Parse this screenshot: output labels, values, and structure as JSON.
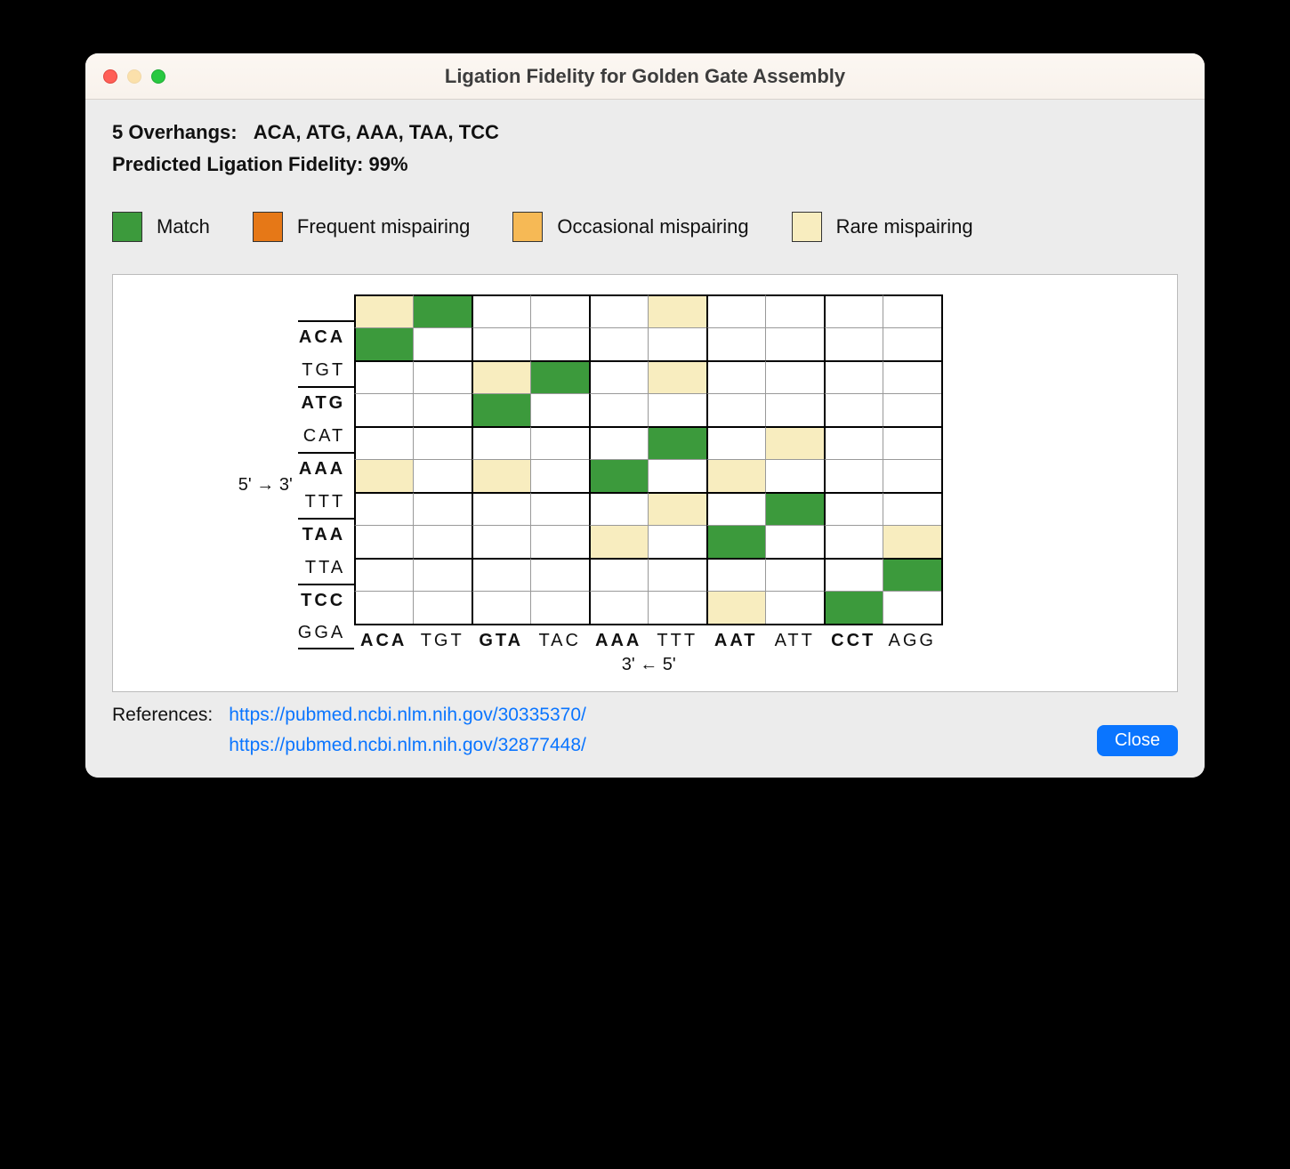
{
  "window": {
    "title": "Ligation Fidelity for Golden Gate Assembly"
  },
  "overhangs_label": "5 Overhangs:",
  "overhangs_list": "ACA, ATG, AAA, TAA, TCC",
  "fidelity_label": "Predicted Ligation Fidelity: 99%",
  "legend": {
    "match": "Match",
    "frequent": "Frequent mispairing",
    "occasional": "Occasional mispairing",
    "rare": "Rare mispairing"
  },
  "axes": {
    "y": "5' → 3'",
    "x": "3' ← 5'"
  },
  "row_headers": [
    {
      "label": "ACA",
      "bold": true
    },
    {
      "label": "TGT",
      "bold": false
    },
    {
      "label": "ATG",
      "bold": true
    },
    {
      "label": "CAT",
      "bold": false
    },
    {
      "label": "AAA",
      "bold": true
    },
    {
      "label": "TTT",
      "bold": false
    },
    {
      "label": "TAA",
      "bold": true
    },
    {
      "label": "TTA",
      "bold": false
    },
    {
      "label": "TCC",
      "bold": true
    },
    {
      "label": "GGA",
      "bold": false
    }
  ],
  "col_headers": [
    {
      "label": "ACA",
      "bold": true
    },
    {
      "label": "TGT",
      "bold": false
    },
    {
      "label": "GTA",
      "bold": true
    },
    {
      "label": "TAC",
      "bold": false
    },
    {
      "label": "AAA",
      "bold": true
    },
    {
      "label": "TTT",
      "bold": false
    },
    {
      "label": "AAT",
      "bold": true
    },
    {
      "label": "ATT",
      "bold": false
    },
    {
      "label": "CCT",
      "bold": true
    },
    {
      "label": "AGG",
      "bold": false
    }
  ],
  "matrix": [
    [
      "rare",
      "match",
      "",
      "",
      "",
      "rare",
      "",
      "",
      "",
      ""
    ],
    [
      "match",
      "",
      "",
      "",
      "",
      "",
      "",
      "",
      "",
      ""
    ],
    [
      "",
      "",
      "rare",
      "match",
      "",
      "rare",
      "",
      "",
      "",
      ""
    ],
    [
      "",
      "",
      "match",
      "",
      "",
      "",
      "",
      "",
      "",
      ""
    ],
    [
      "",
      "",
      "",
      "",
      "",
      "match",
      "",
      "rare",
      "",
      ""
    ],
    [
      "rare",
      "",
      "rare",
      "",
      "match",
      "",
      "rare",
      "",
      "",
      ""
    ],
    [
      "",
      "",
      "",
      "",
      "",
      "rare",
      "",
      "match",
      "",
      ""
    ],
    [
      "",
      "",
      "",
      "",
      "rare",
      "",
      "match",
      "",
      "",
      "rare"
    ],
    [
      "",
      "",
      "",
      "",
      "",
      "",
      "",
      "",
      "",
      "match"
    ],
    [
      "",
      "",
      "",
      "",
      "",
      "",
      "rare",
      "",
      "match",
      ""
    ]
  ],
  "colors": {
    "match": "#3c9a3c",
    "frequent": "#e67817",
    "occasional": "#f6b955",
    "rare": "#f8edbf"
  },
  "references_label": "References:",
  "references": [
    "https://pubmed.ncbi.nlm.nih.gov/30335370/",
    "https://pubmed.ncbi.nlm.nih.gov/32877448/"
  ],
  "close_label": "Close"
}
